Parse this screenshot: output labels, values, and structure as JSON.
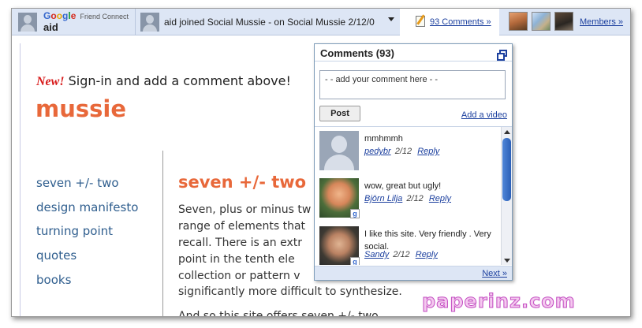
{
  "friend_connect_bar": {
    "logo_google": "Google",
    "logo_product": "Friend Connect",
    "user_name": "aid",
    "activity_text": "aid joined Social Mussie -   on Social Mussie  2/12/0",
    "comments_link": "93 Comments  »",
    "members_link": "Members  »",
    "members": [
      {
        "icon": "member-photo"
      },
      {
        "icon": "member-photo"
      },
      {
        "icon": "member-photo"
      }
    ]
  },
  "blog": {
    "new_label": "New!",
    "sign_in_note": " Sign-in and add a comment above!",
    "title": "mussie",
    "nav": [
      {
        "label": "seven +/- two"
      },
      {
        "label": "design manifesto"
      },
      {
        "label": "turning point"
      },
      {
        "label": "quotes"
      },
      {
        "label": "books"
      }
    ],
    "post_title": "seven +/- two",
    "post_lines": [
      "Seven, plus or minus tw",
      "range of elements that",
      "recall. There is an extr",
      "point in the tenth ele",
      "collection or pattern v",
      "significantly more difficult to synthesize.",
      "And so this site offers seven +/- two"
    ]
  },
  "comments_popup": {
    "title": "Comments (93)",
    "comment_placeholder": "- - add your comment here - -",
    "post_button": "Post",
    "add_video": "Add a video",
    "next": "Next »",
    "comments": [
      {
        "text": "mmhmmh",
        "author": "pedybr",
        "date": "2/12",
        "reply": "Reply"
      },
      {
        "text": "wow, great but ugly!",
        "author": "Björn Lilja",
        "date": "2/12",
        "reply": "Reply"
      },
      {
        "text": "I like this site. Very friendly . Very social.",
        "author": "Sandy",
        "date": "2/12",
        "reply": "Reply"
      }
    ]
  },
  "watermark": "paperinz.com",
  "colors": {
    "bar_background": "#dde6f5",
    "link": "#1b3f9e",
    "blog_accent": "#e8683a",
    "nav_link": "#2f5e8e",
    "new_red": "#d81b1b"
  }
}
